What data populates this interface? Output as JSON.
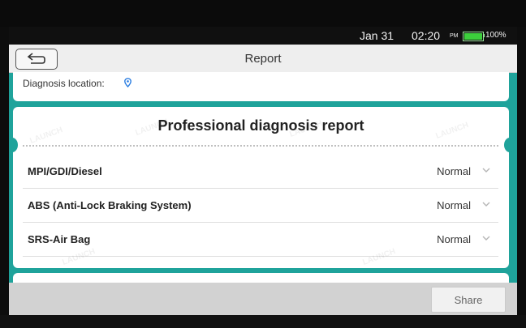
{
  "status_bar": {
    "date": "Jan 31",
    "time": "02:20",
    "ampm": "PM",
    "battery_percent_label": "100%",
    "battery_level": 1.0
  },
  "header": {
    "title": "Report",
    "back_icon": "return-arrow-icon"
  },
  "location": {
    "label": "Diagnosis location:",
    "icon": "location-pin-icon"
  },
  "report": {
    "title": "Professional diagnosis report",
    "rows": [
      {
        "system": "MPI/GDI/Diesel",
        "status": "Normal"
      },
      {
        "system": "ABS (Anti-Lock Braking System)",
        "status": "Normal"
      },
      {
        "system": "SRS-Air Bag",
        "status": "Normal"
      }
    ]
  },
  "footer": {
    "share_label": "Share"
  },
  "colors": {
    "accent": "#1fa39b",
    "pin": "#2a7de1",
    "battery": "#3ccf3c"
  },
  "watermark_text": "LAUNCH"
}
